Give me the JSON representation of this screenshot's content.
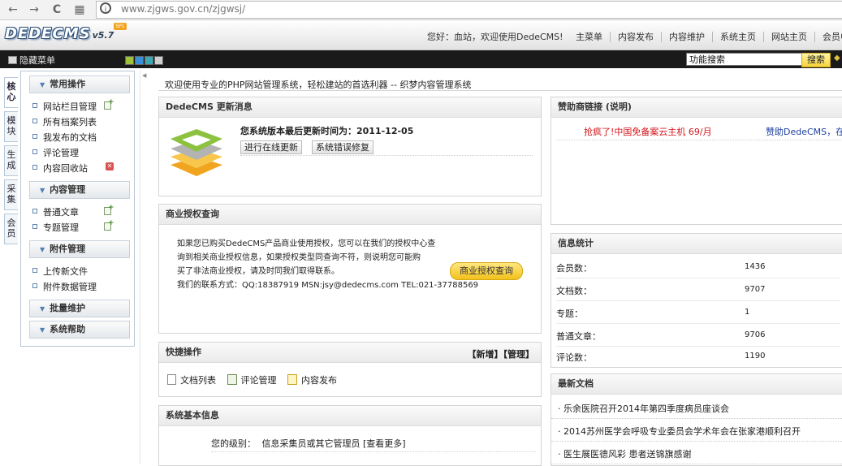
{
  "browser": {
    "url": "www.zjgws.gov.cn/zjgwsj/",
    "back": "←",
    "forward": "→",
    "reload": "C",
    "apps": "▦"
  },
  "header": {
    "logo_text": "DEDECMS",
    "version": "v5.7",
    "welcome": "您好：血站，欢迎使用DedeCMS!",
    "nav": [
      "主菜单",
      "内容发布",
      "内容维护",
      "系统主页",
      "网站主页",
      "会员中"
    ]
  },
  "toolbar": {
    "hide_menu": "隐藏菜单",
    "search_value": "功能搜索",
    "search_button": "搜索"
  },
  "skins": {
    "colors": [
      "#9fc23a",
      "#3a8fd6",
      "#3da7b3",
      "#cfcfcf"
    ]
  },
  "vertical_tabs": [
    "核心",
    "模块",
    "生成",
    "采集",
    "会员"
  ],
  "sidebar": {
    "sections": [
      {
        "title": "常用操作",
        "items": [
          "网站栏目管理",
          "所有档案列表",
          "我发布的文档",
          "评论管理",
          "内容回收站"
        ]
      },
      {
        "title": "内容管理",
        "items": [
          "普通文章",
          "专题管理"
        ]
      },
      {
        "title": "附件管理",
        "items": [
          "上传新文件",
          "附件数据管理"
        ]
      },
      {
        "title": "批量维护",
        "items": []
      },
      {
        "title": "系统帮助",
        "items": []
      }
    ]
  },
  "main": {
    "welcome": "欢迎使用专业的PHP网站管理系统，轻松建站的首选利器 -- 织梦内容管理系统"
  },
  "update_panel": {
    "title": "DedeCMS 更新消息",
    "last_update": "您系统版本最后更新时间为：2011-12-05",
    "btn_online_update": "进行在线更新",
    "btn_fix": "系统错误修复"
  },
  "license_panel": {
    "title": "商业授权查询",
    "lines": [
      "如果您已购买DedeCMS产品商业使用授权，您可以在我们的授权中心查",
      "询到相关商业授权信息，如果授权类型同查询不符，则说明您可能购",
      "买了非法商业授权，请及时同我们取得联系。",
      "我们的联系方式：QQ:18387919 MSN:jsy@dedecms.com TEL:021-37788569"
    ],
    "button": "商业授权查询"
  },
  "quick_panel": {
    "title": "快捷操作",
    "actions": "【新增】【管理】",
    "links": [
      "文档列表",
      "评论管理",
      "内容发布"
    ]
  },
  "sysinfo_panel": {
    "title": "系统基本信息",
    "level_label": "您的级别：",
    "level_value": "信息采集员或其它管理员 [查看更多]"
  },
  "sponsor_panel": {
    "title": "赞助商链接 (说明)",
    "ad1": "抢疯了!中国免备案云主机 69/月",
    "ad2": "赞助DedeCMS，在官方"
  },
  "stats_panel": {
    "title": "信息统计",
    "rows": [
      {
        "label": "会员数：",
        "value": "1436"
      },
      {
        "label": "文档数：",
        "value": "9707"
      },
      {
        "label": "专题：",
        "value": "1"
      },
      {
        "label": "普通文章：",
        "value": "9706"
      },
      {
        "label": "评论数：",
        "value": "1190"
      }
    ]
  },
  "news_panel": {
    "title": "最新文档",
    "items": [
      "· 乐余医院召开2014年第四季度病员座谈会",
      "· 2014苏州医学会呼吸专业委员会学术年会在张家港顺利召开",
      "· 医生展医德风彩 患者送锦旗感谢"
    ]
  }
}
